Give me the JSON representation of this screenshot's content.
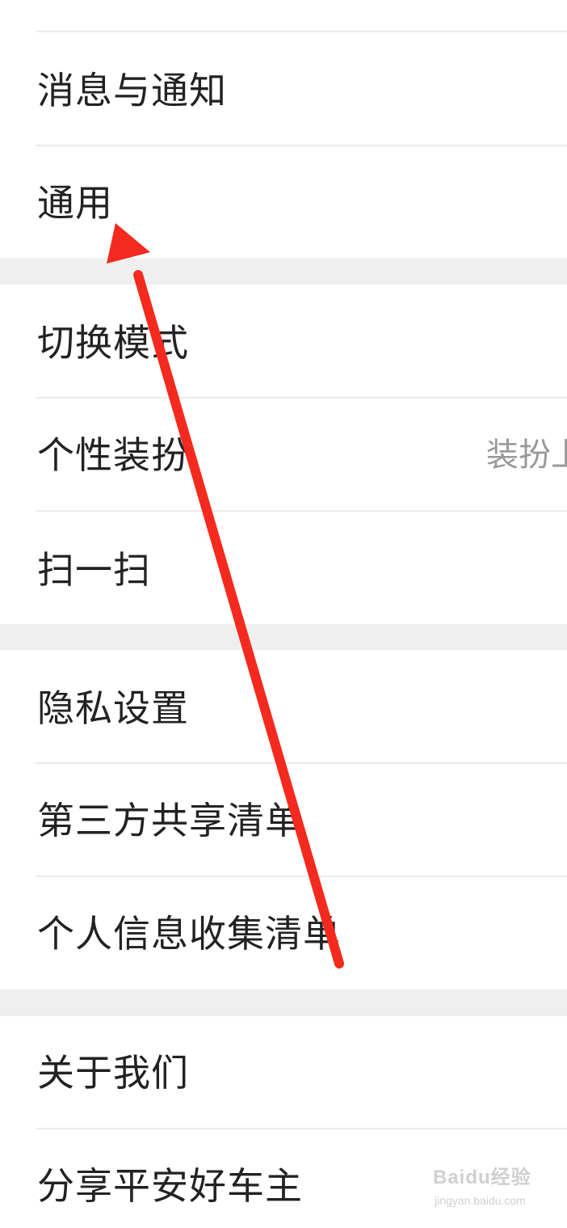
{
  "settings": {
    "items": [
      {
        "label": "消息与通知"
      },
      {
        "label": "通用"
      },
      {
        "label": "切换模式"
      },
      {
        "label": "个性装扮",
        "value": "装扮上"
      },
      {
        "label": "扫一扫"
      },
      {
        "label": "隐私设置"
      },
      {
        "label": "第三方共享清单"
      },
      {
        "label": "个人信息收集清单"
      },
      {
        "label": "关于我们"
      },
      {
        "label": "分享平安好车主"
      }
    ]
  },
  "annotation": {
    "arrow_color": "#f52a1e",
    "arrow_target": "通用"
  },
  "watermark": {
    "brand": "Baidu经验",
    "url": "jingyan.baidu.com"
  }
}
